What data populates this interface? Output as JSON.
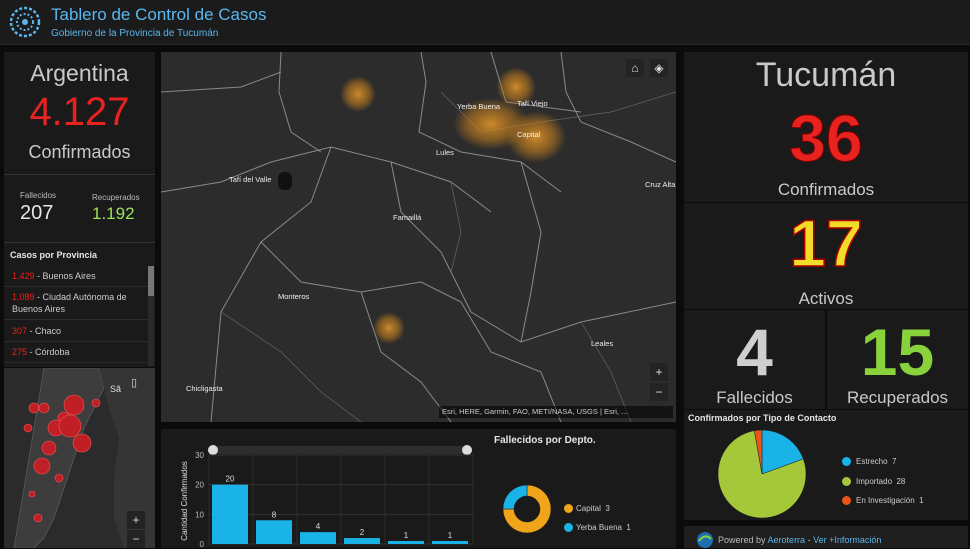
{
  "header": {
    "title": "Tablero de Control de Casos",
    "subtitle": "Gobierno de la Provincia de Tucumán"
  },
  "argentina": {
    "title": "Argentina",
    "confirmed": "4.127",
    "confirmed_label": "Confirmados",
    "deaths_label": "Fallecidos",
    "deaths": "207",
    "recovered_label": "Recuperados",
    "recovered": "1.192"
  },
  "provinces": {
    "header": "Casos por Provincia",
    "items": [
      {
        "num": "1.429",
        "name": "Buenos Aires"
      },
      {
        "num": "1.089",
        "name": "Ciudad Autónoma de Buenos Aires"
      },
      {
        "num": "307",
        "name": "Chaco"
      },
      {
        "num": "275",
        "name": "Córdoba"
      }
    ]
  },
  "minimap": {
    "label": "Sã"
  },
  "map": {
    "labels": [
      "Tafí Viejo",
      "Yerba Buena",
      "Capital",
      "Lules",
      "Tafí del Valle",
      "Cruz Alta",
      "Famaillá",
      "Monteros",
      "Leales",
      "Chicligasta"
    ],
    "attribution": "Esri, HERE, Garmin, FAO, METI/NASA, USGS | Esri, ...",
    "zoom_in": "+",
    "zoom_out": "−"
  },
  "chart_data": [
    {
      "type": "bar",
      "ylabel": "Cantidad Confirmados",
      "ylim": [
        0,
        30
      ],
      "yticks": [
        "0",
        "10",
        "20",
        "30"
      ],
      "values": [
        20,
        8,
        4,
        2,
        1,
        1
      ],
      "value_labels": [
        "20",
        "8",
        "4",
        "2",
        "1",
        "1"
      ],
      "color": "#1ab3e8"
    },
    {
      "type": "pie",
      "title": "Fallecidos por Depto.",
      "donut": true,
      "slices": [
        {
          "name": "Capital",
          "value": 3,
          "color": "#f0a41a"
        },
        {
          "name": "Yerba Buena",
          "value": 1,
          "color": "#1ab3e8"
        }
      ]
    },
    {
      "type": "pie",
      "title": "Confirmados por Tipo de Contacto",
      "slices": [
        {
          "name": "Estrecho",
          "value": 7,
          "color": "#1ab3e8"
        },
        {
          "name": "Importado",
          "value": 28,
          "color": "#a5c83a"
        },
        {
          "name": "En Investigación",
          "value": 1,
          "color": "#e8541a"
        }
      ]
    }
  ],
  "tucuman": {
    "title": "Tucumán",
    "confirmed": "36",
    "confirmed_label": "Confirmados",
    "active": "17",
    "active_label": "Activos",
    "deaths": "4",
    "deaths_label": "Fallecidos",
    "recovered": "15",
    "recovered_label": "Recuperados"
  },
  "footer": {
    "prefix": "Powered by",
    "link1": "Aeroterra",
    "sep": " - ",
    "link2": "Ver +Información"
  },
  "colors": {
    "accent": "#5ab7ef",
    "red": "#e8221f",
    "green": "#9be25a",
    "yellow": "#f2dc2a"
  }
}
